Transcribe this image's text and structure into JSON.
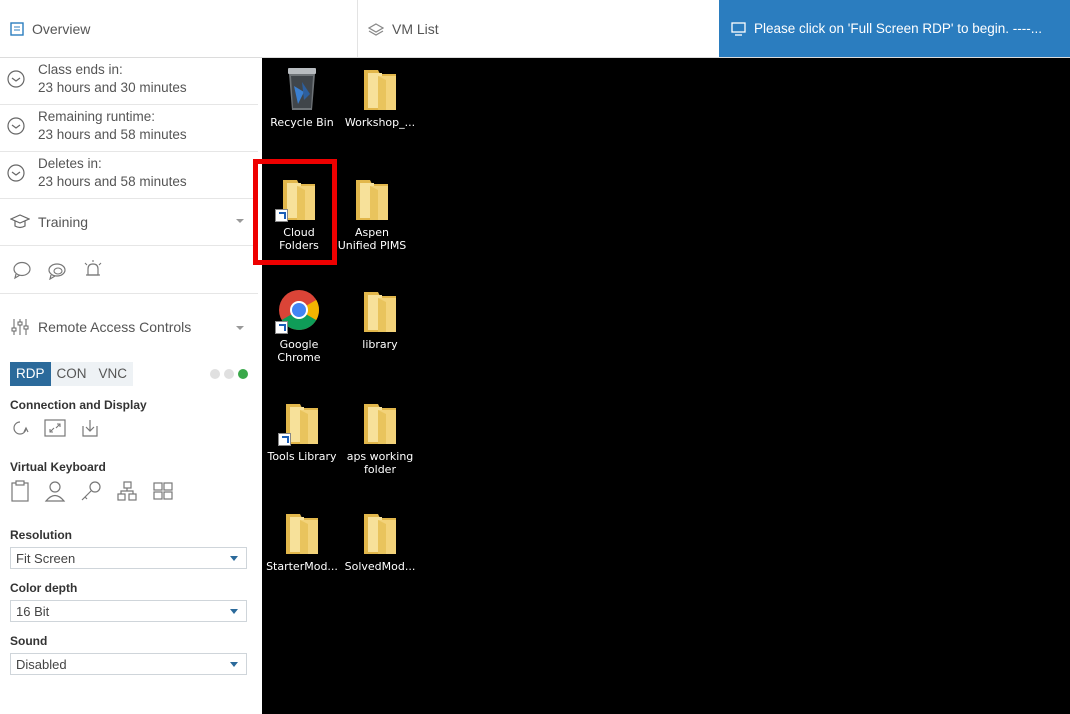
{
  "tabs": {
    "overview": "Overview",
    "vm_list": "VM List",
    "banner": "Please click on 'Full Screen RDP' to begin. ----..."
  },
  "timers": [
    {
      "label": "Class ends in:",
      "value": "23 hours and 30 minutes"
    },
    {
      "label": "Remaining runtime:",
      "value": "23 hours and 58 minutes"
    },
    {
      "label": "Deletes in:",
      "value": "23 hours and 58 minutes"
    }
  ],
  "training": {
    "label": "Training"
  },
  "remote": {
    "label": "Remote Access Controls",
    "protocols": [
      "RDP",
      "CON",
      "VNC"
    ],
    "active_protocol": "RDP",
    "connection_label": "Connection and Display",
    "keyboard_label": "Virtual Keyboard",
    "resolution_label": "Resolution",
    "resolution_value": "Fit Screen",
    "color_label": "Color depth",
    "color_value": "16 Bit",
    "sound_label": "Sound",
    "sound_value": "Disabled"
  },
  "desktop_icons": [
    {
      "label": "Recycle Bin",
      "icon": "recycle-bin-icon"
    },
    {
      "label": "Workshop_...",
      "icon": "folder-icon"
    },
    {
      "label": "Cloud Folders",
      "icon": "folder-shortcut-icon"
    },
    {
      "label": "Aspen Unified PIMS",
      "icon": "folder-icon"
    },
    {
      "label": "Google Chrome",
      "icon": "chrome-icon"
    },
    {
      "label": "library",
      "icon": "folder-icon"
    },
    {
      "label": "Tools Library",
      "icon": "folder-shortcut-icon"
    },
    {
      "label": "aps working folder",
      "icon": "folder-icon"
    },
    {
      "label": "StarterMod...",
      "icon": "folder-icon"
    },
    {
      "label": "SolvedMod...",
      "icon": "folder-icon"
    }
  ],
  "colors": {
    "accent": "#2b7dbf",
    "active_protocol": "#2b6a9b",
    "status_green": "#3aa84a",
    "highlight": "#e00000"
  }
}
